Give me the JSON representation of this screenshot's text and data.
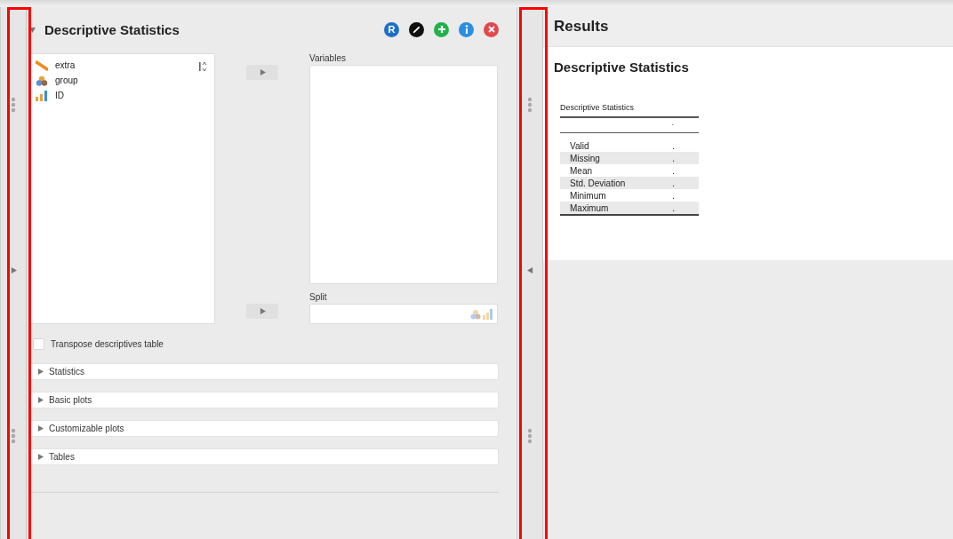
{
  "analysis": {
    "title": "Descriptive Statistics",
    "expanded": true
  },
  "header_buttons": [
    {
      "kind": "r",
      "label": "R"
    },
    {
      "kind": "edit"
    },
    {
      "kind": "add"
    },
    {
      "kind": "info"
    },
    {
      "kind": "close"
    }
  ],
  "variables": [
    {
      "name": "extra",
      "kind": "scale"
    },
    {
      "name": "group",
      "kind": "nominal"
    },
    {
      "name": "ID",
      "kind": "ordinal"
    }
  ],
  "targets": {
    "variables_label": "Variables",
    "split_label": "Split"
  },
  "transpose": {
    "label": "Transpose descriptives table",
    "checked": false
  },
  "sections": [
    {
      "label": "Statistics",
      "expanded": false
    },
    {
      "label": "Basic plots",
      "expanded": false
    },
    {
      "label": "Customizable plots",
      "expanded": false
    },
    {
      "label": "Tables",
      "expanded": false
    }
  ],
  "results": {
    "title": "Results",
    "heading": "Descriptive Statistics",
    "table": {
      "title": "Descriptive Statistics",
      "column_header": ".",
      "rows": [
        {
          "label": "Valid",
          "value": "."
        },
        {
          "label": "Missing",
          "value": "."
        },
        {
          "label": "Mean",
          "value": "."
        },
        {
          "label": "Std. Deviation",
          "value": "."
        },
        {
          "label": "Minimum",
          "value": "."
        },
        {
          "label": "Maximum",
          "value": "."
        }
      ]
    }
  },
  "highlight_frames": [
    {
      "kind": "frame"
    },
    {
      "kind": "frame"
    }
  ]
}
